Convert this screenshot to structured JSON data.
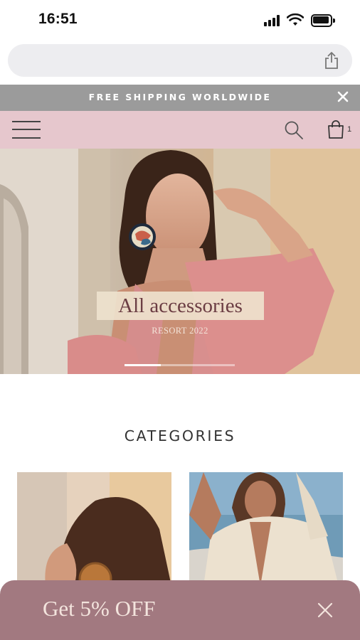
{
  "status_bar": {
    "time": "16:51"
  },
  "announcement": {
    "text": "FREE SHIPPING WORLDWIDE",
    "close_icon": "close-icon"
  },
  "header": {
    "cart_count": "1",
    "menu_icon": "hamburger-icon",
    "search_icon": "search-icon",
    "cart_icon": "shopping-bag-icon"
  },
  "hero": {
    "title": "All accessories",
    "subtitle": "RESORT 2022",
    "slide_progress": 0.33
  },
  "categories": {
    "heading": "CATEGORIES"
  },
  "promo": {
    "text": "Get 5% OFF",
    "close_icon": "close-icon"
  },
  "colors": {
    "announcement_bg": "#9b9b9b",
    "header_bg": "#e6c7cd",
    "promo_bg": "#a27980",
    "hero_title_color": "#6b3d43"
  }
}
